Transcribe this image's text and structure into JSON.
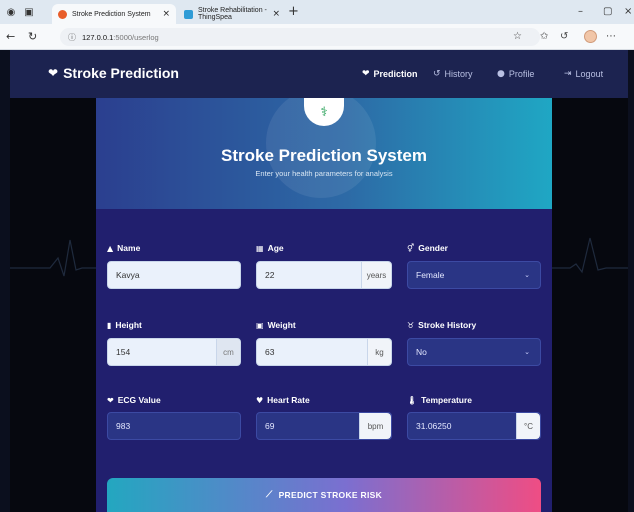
{
  "browser": {
    "tabs": [
      {
        "title": "Stroke Prediction System",
        "active": true,
        "favicon_color": "#e85d2a"
      },
      {
        "title": "Stroke Rehabilitation - ThingSpea",
        "active": false,
        "favicon_color": "#2e9bd6"
      }
    ],
    "url_host": "127.0.0.1",
    "url_path": ":5000/userlog"
  },
  "navbar": {
    "brand": "Stroke Prediction",
    "links": {
      "prediction": "Prediction",
      "history": "History",
      "profile": "Profile",
      "logout": "Logout"
    }
  },
  "hero": {
    "title": "Stroke Prediction System",
    "subtitle": "Enter your health parameters for analysis"
  },
  "form": {
    "name": {
      "label": "Name",
      "value": "Kavya",
      "icon": "user-icon"
    },
    "age": {
      "label": "Age",
      "value": "22",
      "unit": "years",
      "icon": "calendar-icon"
    },
    "gender": {
      "label": "Gender",
      "value": "Female",
      "icon": "gender-icon"
    },
    "height": {
      "label": "Height",
      "value": "154",
      "unit": "cm",
      "icon": "ruler-icon"
    },
    "weight": {
      "label": "Weight",
      "value": "63",
      "unit": "kg",
      "icon": "scale-icon"
    },
    "stroke_history": {
      "label": "Stroke History",
      "value": "No",
      "icon": "history-icon"
    },
    "ecg": {
      "label": "ECG Value",
      "value": "983",
      "icon": "heart-pulse-icon"
    },
    "heart_rate": {
      "label": "Heart Rate",
      "value": "69",
      "unit": "bpm",
      "icon": "heart-icon"
    },
    "temperature": {
      "label": "Temperature",
      "value": "31.06250",
      "unit": "°C",
      "icon": "thermometer-icon"
    }
  },
  "predict_button": "PREDICT STROKE RISK",
  "colors": {
    "navbar": "#1c2350",
    "card": "#211f6e",
    "accent_start": "#23a7c0",
    "accent_end": "#ef4d84"
  }
}
